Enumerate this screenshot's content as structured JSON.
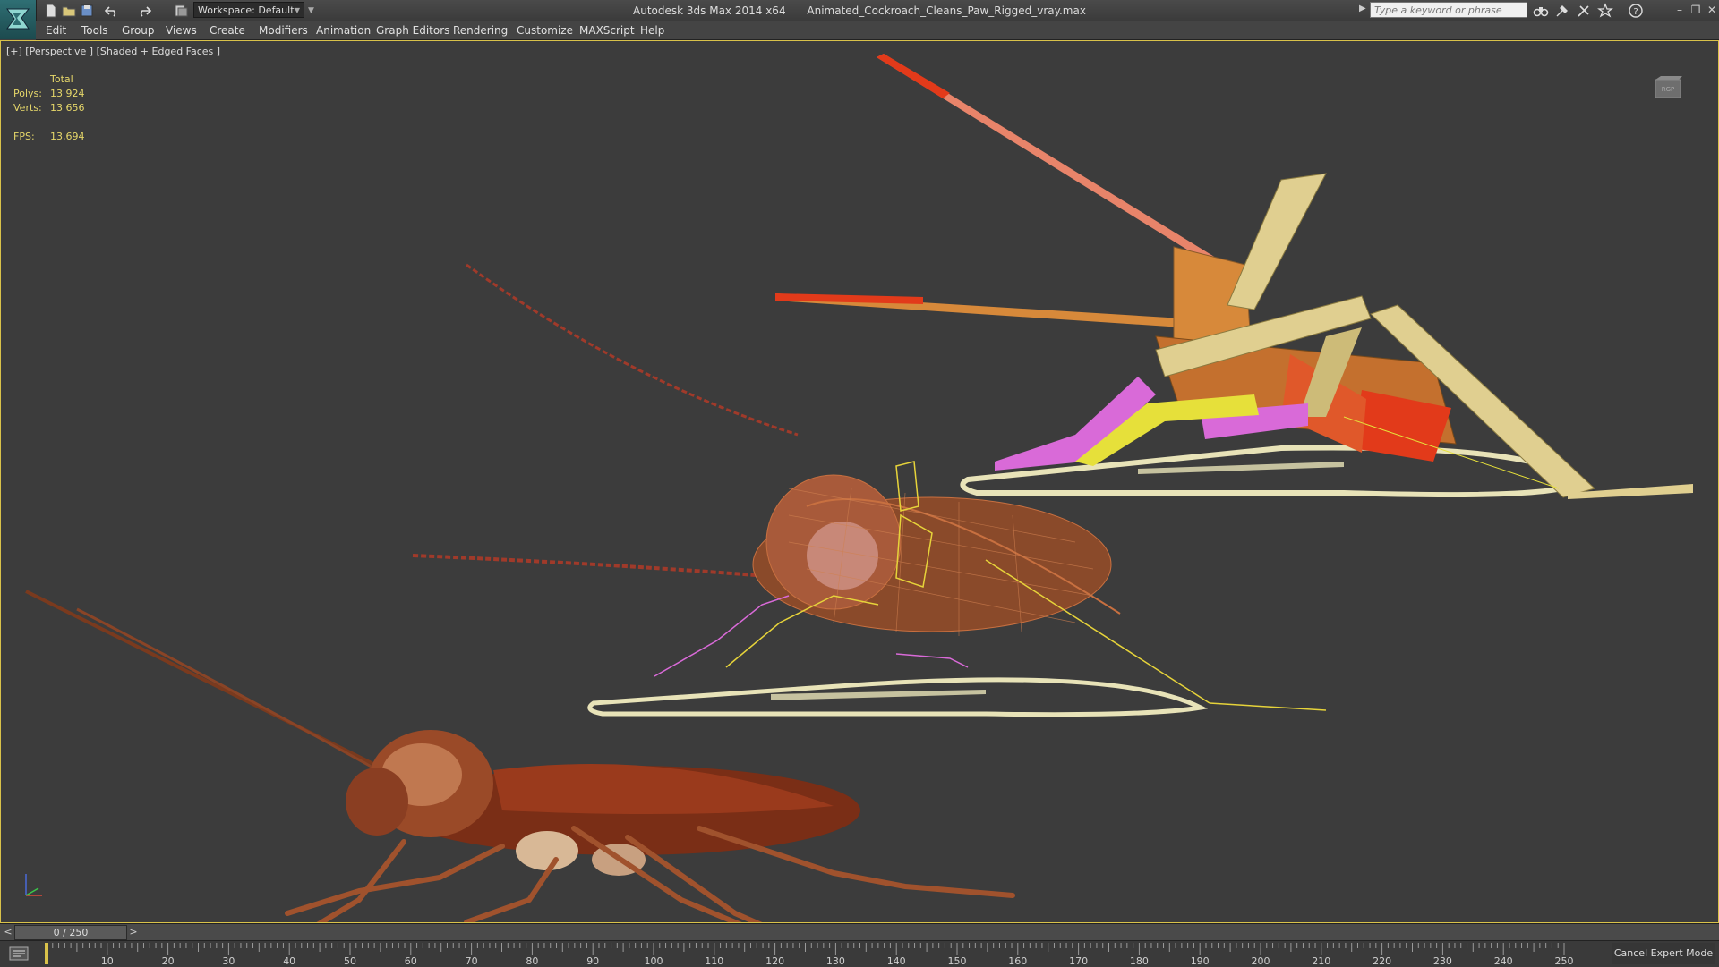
{
  "window": {
    "app_title": "Autodesk 3ds Max  2014 x64",
    "file_name": "Animated_Cockroach_Cleans_Paw_Rigged_vray.max"
  },
  "toolbar": {
    "workspace_label": "Workspace: Default",
    "search_placeholder": "Type a keyword or phrase"
  },
  "menu": [
    "Edit",
    "Tools",
    "Group",
    "Views",
    "Create",
    "Modifiers",
    "Animation",
    "Graph Editors",
    "Rendering",
    "Customize",
    "MAXScript",
    "Help"
  ],
  "viewport": {
    "label": "[+] [Perspective ] [Shaded + Edged Faces ]",
    "stats": {
      "header": "Total",
      "polys_label": "Polys:",
      "polys_value": "13 924",
      "verts_label": "Verts:",
      "verts_value": "13 656",
      "fps_label": "FPS:",
      "fps_value": "13,694"
    },
    "viewcube_label": "RGP"
  },
  "timeslider": {
    "position_text": "0 / 250",
    "prev": "<",
    "next": ">"
  },
  "trackbar": {
    "ticks": [
      "10",
      "20",
      "30",
      "40",
      "50",
      "60",
      "70",
      "80",
      "90",
      "100",
      "110",
      "120",
      "130",
      "140",
      "150",
      "160",
      "170",
      "180",
      "190",
      "200",
      "210",
      "220",
      "230",
      "240",
      "250"
    ],
    "expert_mode_label": "Cancel Expert Mode"
  },
  "colors": {
    "viewport_bg": "#3c3c3c",
    "active_border": "#d9c24a",
    "stats_text": "#e6d76a",
    "bone_tan": "#e0cf90",
    "bone_orange": "#d7893a",
    "bone_red": "#e23a1a",
    "bone_pink": "#d96ad8",
    "bone_yellow": "#e6e03a",
    "cockroach_body": "#8a3a1e"
  }
}
